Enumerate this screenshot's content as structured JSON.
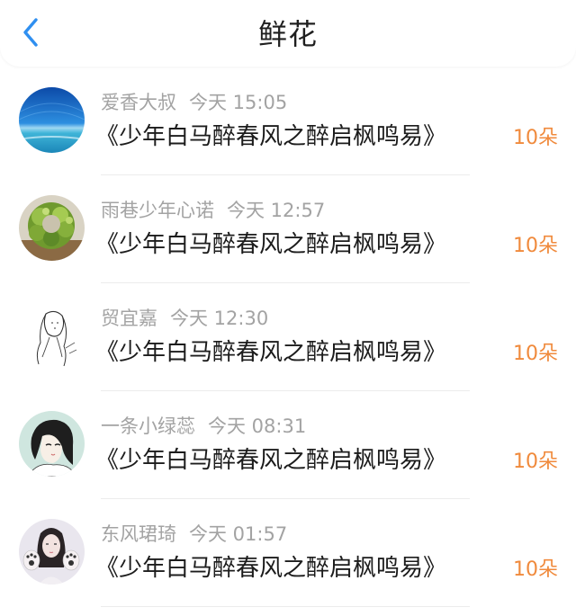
{
  "header": {
    "title": "鲜花",
    "back_icon": "chevron-left-icon",
    "accent_color": "#2f8ff0"
  },
  "items": [
    {
      "name": "爱香大叔",
      "time": "今天 15:05",
      "title": "《少年白马醉春风之醉启枫鸣易》",
      "count": "10朵",
      "avatar": "sea-sky-avatar"
    },
    {
      "name": "雨巷少年心诺",
      "time": "今天 12:57",
      "title": "《少年白马醉春风之醉启枫鸣易》",
      "count": "10朵",
      "avatar": "plant-wreath-avatar"
    },
    {
      "name": "贸宜嘉",
      "time": "今天 12:30",
      "title": "《少年白马醉春风之醉启枫鸣易》",
      "count": "10朵",
      "avatar": "sketch-girl-avatar"
    },
    {
      "name": "一条小绿蕊",
      "time": "今天 08:31",
      "title": "《少年白马醉春风之醉启枫鸣易》",
      "count": "10朵",
      "avatar": "anime-girl-avatar"
    },
    {
      "name": "东风珺琦",
      "time": "今天 01:57",
      "title": "《少年白马醉春风之醉启枫鸣易》",
      "count": "10朵",
      "avatar": "girl-cat-paws-avatar"
    }
  ],
  "colors": {
    "count": "#f08a3c",
    "meta": "#a3a3a3",
    "text": "#1c1c1c"
  }
}
